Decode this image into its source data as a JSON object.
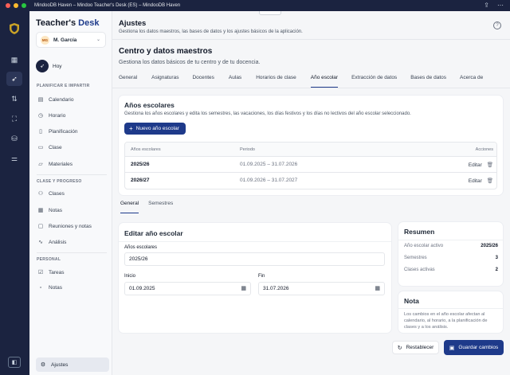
{
  "window": {
    "title": "MindooDB Haven – Mindoo Teacher's Desk (ES) – MindooDB Haven"
  },
  "brand": {
    "part1": "Teacher's",
    "part2": "Desk"
  },
  "user": {
    "initials": "MG",
    "name": "M. García"
  },
  "sidebar": {
    "today": "Hoy",
    "sections": [
      {
        "title": "PLANIFICAR E IMPARTIR",
        "items": [
          "Calendario",
          "Horario",
          "Planificación",
          "Clase",
          "Materiales"
        ]
      },
      {
        "title": "CLASE Y PROGRESO",
        "items": [
          "Clases",
          "Notas",
          "Reuniones y notas",
          "Análisis"
        ]
      },
      {
        "title": "PERSONAL",
        "items": [
          "Tareas",
          "Notas"
        ]
      }
    ],
    "settings": "Ajustes"
  },
  "header": {
    "title": "Ajustes",
    "subtitle": "Gestiona los datos maestros, las bases de datos y los ajustes básicos de la aplicación."
  },
  "section": {
    "title": "Centro y datos maestros",
    "subtitle": "Gestiona los datos básicos de tu centro y de tu docencia."
  },
  "tabs": [
    "General",
    "Asignaturas",
    "Docentes",
    "Aulas",
    "Horarios de clase",
    "Año escolar",
    "Extracción de datos",
    "Bases de datos",
    "Acerca de"
  ],
  "years": {
    "title": "Años escolares",
    "subtitle": "Gestiona los años escolares y edita los semestres, las vacaciones, los días festivos y los días no lectivos del año escolar seleccionado.",
    "new_button": "Nuevo año escolar",
    "columns": [
      "Años escolares",
      "Periodo",
      "Acciones"
    ],
    "rows": [
      {
        "year": "2025/26",
        "period": "01.09.2025 – 31.07.2026",
        "action": "Editar"
      },
      {
        "year": "2026/27",
        "period": "01.09.2026 – 31.07.2027",
        "action": "Editar"
      }
    ]
  },
  "subtabs": [
    "General",
    "Semestres"
  ],
  "edit": {
    "title": "Editar año escolar",
    "year_label": "Años escolares",
    "year_value": "2025/26",
    "start_label": "Inicio",
    "start_value": "01.09.2025",
    "end_label": "Fin",
    "end_value": "31.07.2026"
  },
  "summary": {
    "title": "Resumen",
    "rows": [
      {
        "label": "Año escolar activo",
        "value": "2025/26"
      },
      {
        "label": "Semestres",
        "value": "3"
      },
      {
        "label": "Clases activas",
        "value": "2"
      }
    ]
  },
  "note": {
    "title": "Nota",
    "text": "Los cambios en el año escolar afectan al calendario, al horario, a la planificación de clases y a los análisis."
  },
  "actions": {
    "reset": "Restablecer",
    "save": "Guardar cambios"
  },
  "colors": {
    "navy": "#1b2340",
    "accent": "#1e3a8a"
  }
}
